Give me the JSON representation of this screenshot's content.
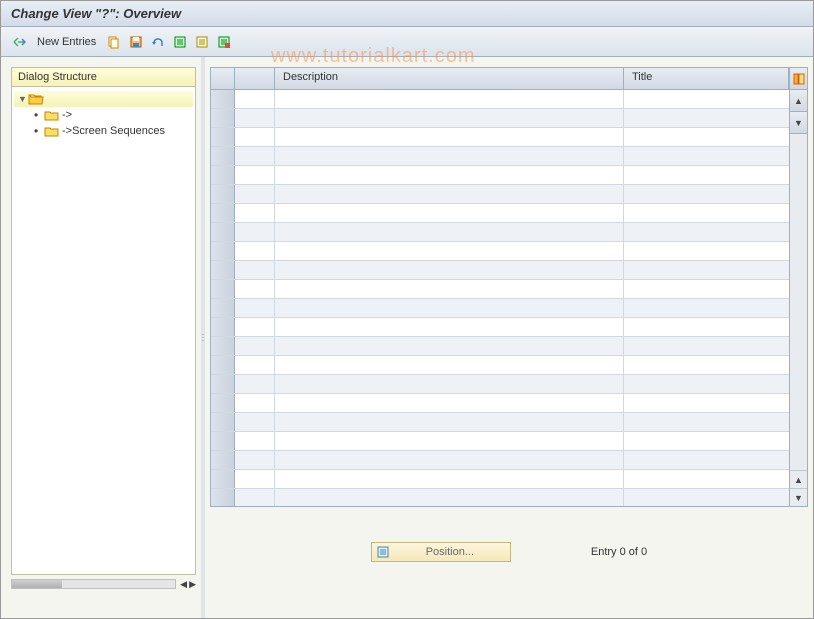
{
  "title": "Change View \"?\": Overview",
  "toolbar": {
    "new_entries_label": "New Entries"
  },
  "watermark": "www.tutorialkart.com",
  "tree": {
    "header": "Dialog Structure",
    "root_label": "",
    "item1_label": "->",
    "item2_label": "->Screen Sequences"
  },
  "grid": {
    "columns": {
      "description": "Description",
      "title": "Title"
    }
  },
  "footer": {
    "position_label": "Position...",
    "entry_status": "Entry 0 of 0"
  }
}
